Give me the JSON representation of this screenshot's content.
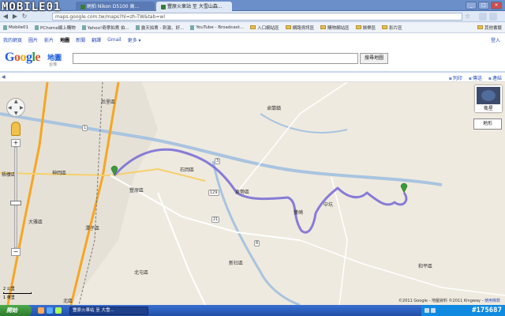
{
  "watermark": "MOBILE01",
  "browser": {
    "tabs": [
      {
        "label": "刷拍 Nikon D5100 高..."
      },
      {
        "label": "豐原火車站 至 大雪山森..."
      }
    ],
    "url": "maps.google.com.tw/maps?hl=zh-TW&tab=wl",
    "bookmarks": [
      {
        "label": "Mobile01",
        "type": "page"
      },
      {
        "label": "PChome線上購物",
        "type": "page"
      },
      {
        "label": "Yahoo!奇摩拍賣 拍...",
        "type": "page"
      },
      {
        "label": "露天拍賣 - 刺激、好...",
        "type": "page"
      },
      {
        "label": "YouTube - Broadcast...",
        "type": "page"
      },
      {
        "label": "入口網站區",
        "type": "folder"
      },
      {
        "label": "網路資訊區",
        "type": "folder"
      },
      {
        "label": "購物網站區",
        "type": "folder"
      },
      {
        "label": "娛樂區",
        "type": "folder"
      },
      {
        "label": "影片區",
        "type": "folder"
      }
    ],
    "other_bookmarks": "其他書籤"
  },
  "gbar": {
    "links": [
      "我的網頁",
      "圖片",
      "影片",
      "地圖",
      "新聞",
      "翻譯",
      "Gmail",
      "更多 ▾"
    ],
    "active_index": 3,
    "signin": "登入"
  },
  "header": {
    "logo_suffix": "地圖",
    "logo_region": "台灣",
    "search_value": "",
    "search_button": "搜尋地圖"
  },
  "maptools": {
    "print": "列印",
    "send": "傳送",
    "link": "連結"
  },
  "map": {
    "satellite_label": "衛星",
    "terrain_label": "地形",
    "scale_top": "2 公里",
    "scale_bottom": "1 英里",
    "attribution": "©2011 Google - 地圖資料 ©2011 Kingway -",
    "terms": "使用條款",
    "places": [
      {
        "name": "后里區"
      },
      {
        "name": "卓蘭鎮"
      },
      {
        "name": "東勢區"
      },
      {
        "name": "石岡區"
      },
      {
        "name": "豐原區"
      },
      {
        "name": "神岡區"
      },
      {
        "name": "大雅區"
      },
      {
        "name": "潭子區"
      },
      {
        "name": "新社區"
      },
      {
        "name": "北屯區"
      },
      {
        "name": "和平區"
      },
      {
        "name": "北區"
      },
      {
        "name": "梧棲區"
      },
      {
        "name": "中坑"
      },
      {
        "name": "雙崎"
      }
    ],
    "roads": [
      "1",
      "3",
      "8",
      "21",
      "129"
    ]
  },
  "taskbar": {
    "start": "開始",
    "task_label": "豐原火車站 至 大雪...",
    "clock": "#175687"
  },
  "colors": {
    "route": "#7b6fd6",
    "highway": "#f5a623",
    "river": "#a8c4e0",
    "land": "#efeadf",
    "mountain_road": "#ffffff"
  }
}
